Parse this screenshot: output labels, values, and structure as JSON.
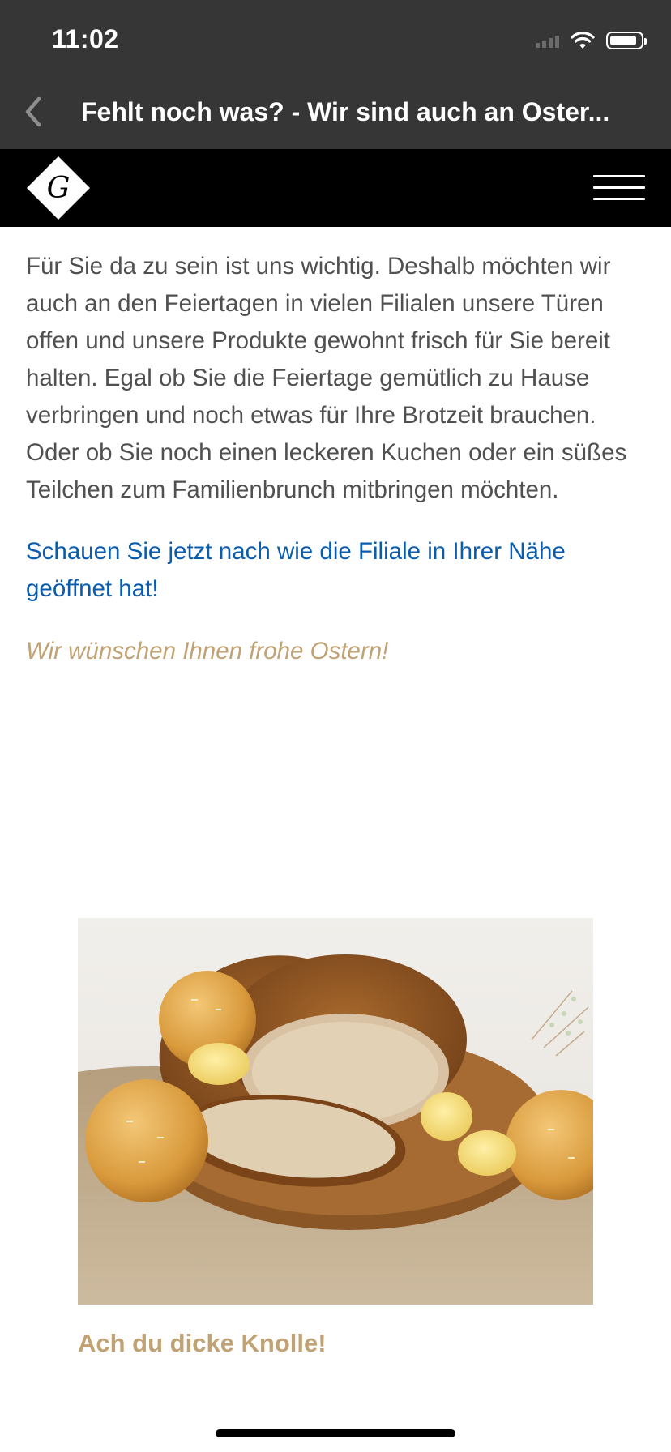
{
  "status_bar": {
    "time": "11:02"
  },
  "nav": {
    "title": "Fehlt noch was? - Wir sind auch an Oster..."
  },
  "header": {
    "logo_letter": "G"
  },
  "content": {
    "paragraph": "Für Sie da zu sein ist uns wichtig. Deshalb möchten wir auch an den Feiertagen in vielen Filialen unsere Türen offen und unsere Produkte gewohnt frisch für Sie bereit halten. Egal ob Sie die Feiertage gemütlich zu Hause verbringen und noch etwas für Ihre Brotzeit brauchen. Oder ob Sie noch einen leckeren Kuchen oder ein süßes Teilchen zum Familienbrunch mitbringen möchten.",
    "link_text": "Schauen Sie jetzt nach wie die Filiale in Ihrer Nähe geöffnet hat!",
    "wish": "Wir wünschen Ihnen frohe Ostern!"
  },
  "promo": {
    "caption": "Ach du dicke Knolle!"
  },
  "colors": {
    "bar": "#363636",
    "header": "#000000",
    "text": "#505050",
    "link": "#0a5cad",
    "accent": "#c0a274"
  },
  "icons": [
    "back-chevron-icon",
    "signal-icon",
    "wifi-icon",
    "battery-icon",
    "hamburger-menu-icon"
  ]
}
